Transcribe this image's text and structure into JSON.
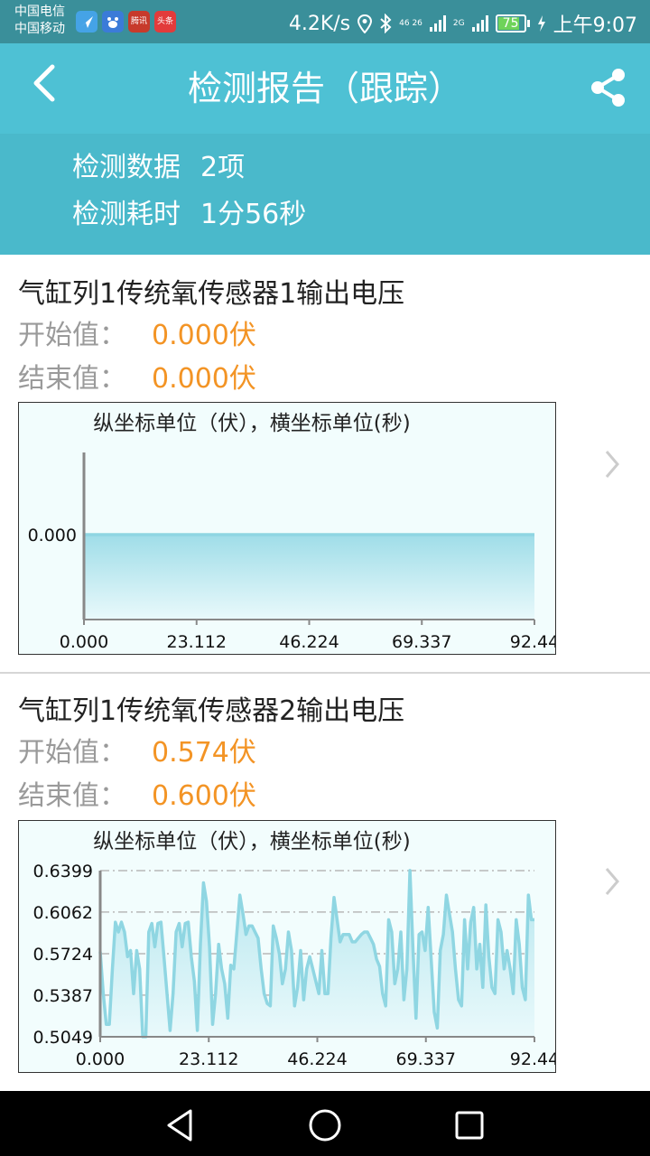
{
  "status_bar": {
    "carrier_1": "中国电信",
    "carrier_2": "中国移动",
    "app_icon_labels": [
      "",
      "",
      "腾讯",
      "头条"
    ],
    "net_speed": "4.2K/s",
    "network_1": "46 26",
    "network_2": "2G",
    "battery": "75",
    "time": "上午9:07"
  },
  "header": {
    "title": "检测报告（跟踪）",
    "back_icon": "chevron-left-icon",
    "share_icon": "share-icon"
  },
  "summary": {
    "items": [
      {
        "label": "检测数据",
        "value": "2项"
      },
      {
        "label": "检测耗时",
        "value": "1分56秒"
      }
    ]
  },
  "reports": [
    {
      "title": "气缸列1传统氧传感器1输出电压",
      "start_label": "开始值：",
      "start_value": "0.000伏",
      "end_label": "结束值：",
      "end_value": "0.000伏"
    },
    {
      "title": "气缸列1传统氧传感器2输出电压",
      "start_label": "开始值：",
      "start_value": "0.574伏",
      "end_label": "结束值：",
      "end_value": "0.600伏"
    }
  ],
  "chart_data": [
    {
      "type": "area",
      "title": "纵坐标单位（伏），横坐标单位(秒)",
      "x_ticks": [
        "0.000",
        "23.112",
        "46.224",
        "69.337",
        "92.44"
      ],
      "y_ticks": [
        "0.000"
      ],
      "xlim": [
        0,
        92.449
      ],
      "ylim": [
        0,
        0.001
      ],
      "series": [
        {
          "values": [
            0,
            0,
            0,
            0,
            0,
            0,
            0,
            0,
            0,
            0
          ]
        }
      ],
      "line_color": "#8fd6e2",
      "fill_color": "#9fdde8"
    },
    {
      "type": "area",
      "title": "纵坐标单位（伏），横坐标单位(秒)",
      "x_ticks": [
        "0.000",
        "23.112",
        "46.224",
        "69.337",
        "92.44"
      ],
      "y_ticks": [
        "0.6399",
        "0.6062",
        "0.5724",
        "0.5387",
        "0.5049"
      ],
      "xlim": [
        0,
        92.449
      ],
      "ylim": [
        0.5049,
        0.6399
      ],
      "grid": true,
      "series": [
        {
          "values": [
            0.574,
            0.54,
            0.515,
            0.515,
            0.56,
            0.598,
            0.59,
            0.598,
            0.59,
            0.57,
            0.575,
            0.54,
            0.575,
            0.56,
            0.505,
            0.505,
            0.59,
            0.597,
            0.578,
            0.597,
            0.598,
            0.57,
            0.54,
            0.51,
            0.54,
            0.59,
            0.597,
            0.578,
            0.597,
            0.598,
            0.57,
            0.55,
            0.51,
            0.58,
            0.63,
            0.615,
            0.578,
            0.515,
            0.54,
            0.58,
            0.56,
            0.548,
            0.52,
            0.563,
            0.56,
            0.59,
            0.62,
            0.605,
            0.588,
            0.595,
            0.595,
            0.59,
            0.585,
            0.56,
            0.54,
            0.532,
            0.53,
            0.595,
            0.585,
            0.572,
            0.548,
            0.56,
            0.59,
            0.575,
            0.53,
            0.545,
            0.575,
            0.535,
            0.56,
            0.57,
            0.56,
            0.55,
            0.54,
            0.575,
            0.54,
            0.54,
            0.585,
            0.618,
            0.6,
            0.582,
            0.588,
            0.588,
            0.588,
            0.582,
            0.582,
            0.585,
            0.588,
            0.59,
            0.59,
            0.585,
            0.58,
            0.568,
            0.562,
            0.54,
            0.53,
            0.6,
            0.59,
            0.548,
            0.56,
            0.59,
            0.535,
            0.56,
            0.64,
            0.575,
            0.52,
            0.588,
            0.59,
            0.575,
            0.61,
            0.568,
            0.525,
            0.512,
            0.575,
            0.588,
            0.62,
            0.605,
            0.59,
            0.56,
            0.535,
            0.53,
            0.6,
            0.56,
            0.598,
            0.61,
            0.56,
            0.58,
            0.545,
            0.612,
            0.57,
            0.545,
            0.54,
            0.6,
            0.59,
            0.56,
            0.575,
            0.56,
            0.54,
            0.6,
            0.58,
            0.545,
            0.535,
            0.62,
            0.6,
            0.6
          ]
        }
      ],
      "line_color": "#8fd6e2",
      "fill_color": "#b5e6ee",
      "grid_color": "#b8b8b8"
    }
  ],
  "nav_bar": {
    "back_icon": "triangle-back-icon",
    "home_icon": "circle-home-icon",
    "recents_icon": "square-recents-icon"
  }
}
